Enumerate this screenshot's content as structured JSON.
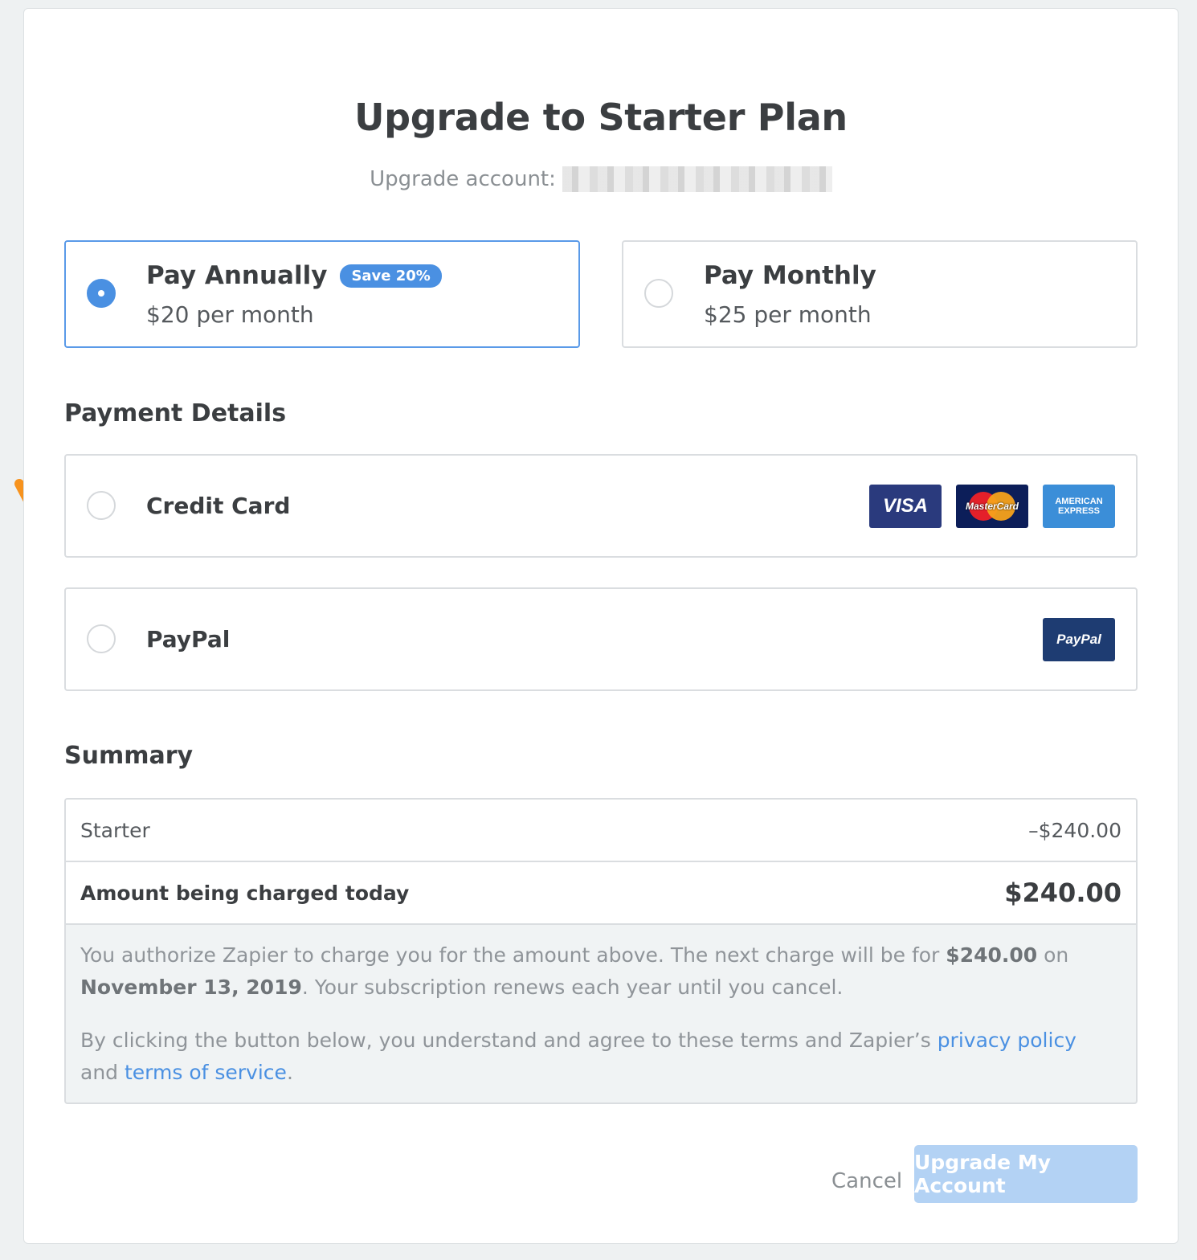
{
  "header": {
    "title": "Upgrade to Starter Plan",
    "account_label": "Upgrade account:"
  },
  "plans": [
    {
      "name": "Pay Annually",
      "badge": "Save 20%",
      "price": "$20 per month",
      "selected": true
    },
    {
      "name": "Pay Monthly",
      "price": "$25 per month",
      "selected": false
    }
  ],
  "payment": {
    "heading": "Payment Details",
    "methods": [
      {
        "label": "Credit Card",
        "logos": [
          "VISA",
          "MasterCard",
          "AMERICAN EXPRESS"
        ]
      },
      {
        "label": "PayPal",
        "logos": [
          "PayPal"
        ]
      }
    ]
  },
  "summary": {
    "heading": "Summary",
    "line_label": "Starter",
    "line_value": "–$240.00",
    "total_label": "Amount being charged today",
    "total_value": "$240.00",
    "terms1_a": "You authorize Zapier to charge you for the amount above. The next charge will be for ",
    "terms1_amount": "$240.00",
    "terms1_b": " on ",
    "terms1_date": "November 13, 2019",
    "terms1_c": ". Your subscription renews each year until you cancel.",
    "terms2_a": "By clicking the button below, you understand and agree to these terms and Zapier’s ",
    "privacy_link": "privacy policy",
    "terms2_b": " and ",
    "tos_link": "terms of service",
    "terms2_c": "."
  },
  "actions": {
    "cancel": "Cancel",
    "upgrade": "Upgrade My Account"
  },
  "colors": {
    "accent": "#4a90e2",
    "annotation_arrow": "#f7931e",
    "button_disabled": "#b3d2f4"
  }
}
